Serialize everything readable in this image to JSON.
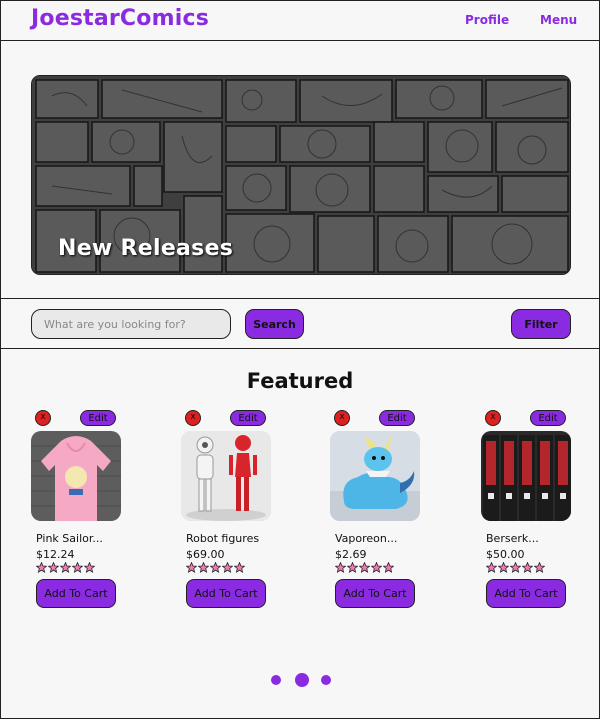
{
  "header": {
    "logo": "JoestarComics",
    "nav": {
      "profile": "Profile",
      "menu": "Menu"
    }
  },
  "hero": {
    "title": "New Releases"
  },
  "search": {
    "placeholder": "What are you looking for?",
    "value": "",
    "search_label": "Search",
    "filter_label": "Filter"
  },
  "featured": {
    "title": "Featured",
    "products": [
      {
        "name": "Pink Sailor...",
        "price": "$12.24",
        "rating": 0,
        "edit_label": "Edit",
        "delete_label": "x",
        "cart_label": "Add To Cart"
      },
      {
        "name": "Robot figures",
        "price": "$69.00",
        "rating": 0,
        "edit_label": "Edit",
        "delete_label": "x",
        "cart_label": "Add To Cart"
      },
      {
        "name": "Vaporeon...",
        "price": "$2.69",
        "rating": 0,
        "edit_label": "Edit",
        "delete_label": "x",
        "cart_label": "Add To Cart"
      },
      {
        "name": "Berserk...",
        "price": "$50.00",
        "rating": 0,
        "edit_label": "Edit",
        "delete_label": "x",
        "cart_label": "Add To Cart"
      }
    ]
  },
  "pagination": {
    "pages": 3,
    "current": 2
  },
  "colors": {
    "accent": "#8a2be2",
    "delete": "#e02020",
    "star": "#f27ab5"
  }
}
